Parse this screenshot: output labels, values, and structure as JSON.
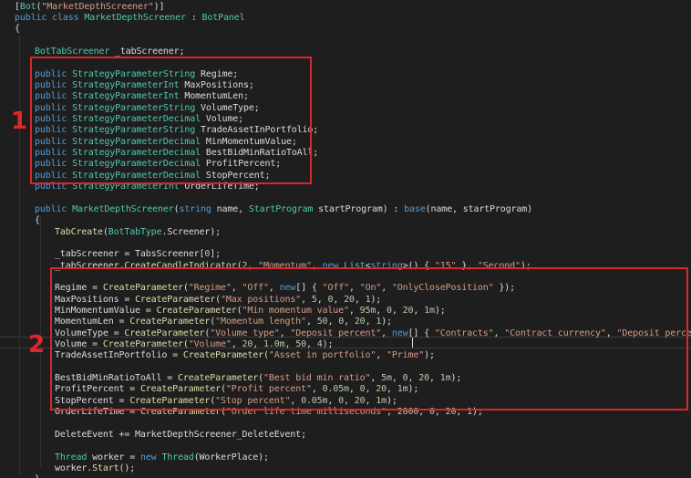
{
  "code_lines": [
    {
      "indent": 0,
      "tokens": [
        [
          "pl",
          "["
        ],
        [
          "ty",
          "Bot"
        ],
        [
          "pl",
          "("
        ],
        [
          "st",
          "\"MarketDepthScreener\""
        ],
        [
          "pl",
          ")]"
        ]
      ]
    },
    {
      "indent": 0,
      "tokens": [
        [
          "kw",
          "public"
        ],
        [
          "pl",
          " "
        ],
        [
          "kw",
          "class"
        ],
        [
          "pl",
          " "
        ],
        [
          "ty",
          "MarketDepthScreener"
        ],
        [
          "pl",
          " : "
        ],
        [
          "ty",
          "BotPanel"
        ]
      ]
    },
    {
      "indent": 0,
      "tokens": [
        [
          "pl",
          "{"
        ]
      ]
    },
    {
      "indent": 0,
      "tokens": []
    },
    {
      "indent": 1,
      "tokens": [
        [
          "ty",
          "BotTabScreener"
        ],
        [
          "pl",
          " _tabScreener;"
        ]
      ]
    },
    {
      "indent": 0,
      "tokens": []
    },
    {
      "indent": 1,
      "tokens": [
        [
          "kw",
          "public"
        ],
        [
          "pl",
          " "
        ],
        [
          "ty",
          "StrategyParameterString"
        ],
        [
          "pl",
          " Regime;"
        ]
      ]
    },
    {
      "indent": 1,
      "tokens": [
        [
          "kw",
          "public"
        ],
        [
          "pl",
          " "
        ],
        [
          "ty",
          "StrategyParameterInt"
        ],
        [
          "pl",
          " MaxPositions;"
        ]
      ]
    },
    {
      "indent": 1,
      "tokens": [
        [
          "kw",
          "public"
        ],
        [
          "pl",
          " "
        ],
        [
          "ty",
          "StrategyParameterInt"
        ],
        [
          "pl",
          " MomentumLen;"
        ]
      ]
    },
    {
      "indent": 1,
      "tokens": [
        [
          "kw",
          "public"
        ],
        [
          "pl",
          " "
        ],
        [
          "ty",
          "StrategyParameterString"
        ],
        [
          "pl",
          " VolumeType;"
        ]
      ]
    },
    {
      "indent": 1,
      "tokens": [
        [
          "kw",
          "public"
        ],
        [
          "pl",
          " "
        ],
        [
          "ty",
          "StrategyParameterDecimal"
        ],
        [
          "pl",
          " Volume;"
        ]
      ]
    },
    {
      "indent": 1,
      "tokens": [
        [
          "kw",
          "public"
        ],
        [
          "pl",
          " "
        ],
        [
          "ty",
          "StrategyParameterString"
        ],
        [
          "pl",
          " TradeAssetInPortfolio;"
        ]
      ]
    },
    {
      "indent": 1,
      "tokens": [
        [
          "kw",
          "public"
        ],
        [
          "pl",
          " "
        ],
        [
          "ty",
          "StrategyParameterDecimal"
        ],
        [
          "pl",
          " MinMomentumValue;"
        ]
      ]
    },
    {
      "indent": 1,
      "tokens": [
        [
          "kw",
          "public"
        ],
        [
          "pl",
          " "
        ],
        [
          "ty",
          "StrategyParameterDecimal"
        ],
        [
          "pl",
          " BestBidMinRatioToAll;"
        ]
      ]
    },
    {
      "indent": 1,
      "tokens": [
        [
          "kw",
          "public"
        ],
        [
          "pl",
          " "
        ],
        [
          "ty",
          "StrategyParameterDecimal"
        ],
        [
          "pl",
          " ProfitPercent;"
        ]
      ]
    },
    {
      "indent": 1,
      "tokens": [
        [
          "kw",
          "public"
        ],
        [
          "pl",
          " "
        ],
        [
          "ty",
          "StrategyParameterDecimal"
        ],
        [
          "pl",
          " StopPercent;"
        ]
      ]
    },
    {
      "indent": 1,
      "tokens": [
        [
          "kw",
          "public"
        ],
        [
          "pl",
          " "
        ],
        [
          "ty",
          "StrategyParameterInt"
        ],
        [
          "pl",
          " OrderLifeTime;"
        ]
      ]
    },
    {
      "indent": 0,
      "tokens": []
    },
    {
      "indent": 1,
      "tokens": [
        [
          "kw",
          "public"
        ],
        [
          "pl",
          " "
        ],
        [
          "ty",
          "MarketDepthScreener"
        ],
        [
          "pl",
          "("
        ],
        [
          "kw",
          "string"
        ],
        [
          "pl",
          " name, "
        ],
        [
          "ty",
          "StartProgram"
        ],
        [
          "pl",
          " startProgram) : "
        ],
        [
          "kw",
          "base"
        ],
        [
          "pl",
          "(name, startProgram)"
        ]
      ]
    },
    {
      "indent": 1,
      "tokens": [
        [
          "pl",
          "{"
        ]
      ]
    },
    {
      "indent": 2,
      "tokens": [
        [
          "mt",
          "TabCreate"
        ],
        [
          "pl",
          "("
        ],
        [
          "ty",
          "BotTabType"
        ],
        [
          "pl",
          "."
        ],
        [
          "pl",
          "Screener"
        ],
        [
          "pl",
          ");"
        ]
      ]
    },
    {
      "indent": 0,
      "tokens": []
    },
    {
      "indent": 2,
      "tokens": [
        [
          "pl",
          "_tabScreener = TabsScreener["
        ],
        [
          "nu",
          "0"
        ],
        [
          "pl",
          "];"
        ]
      ]
    },
    {
      "indent": 2,
      "tokens": [
        [
          "pl",
          "_tabScreener."
        ],
        [
          "mt",
          "CreateCandleIndicator"
        ],
        [
          "pl",
          "("
        ],
        [
          "nu",
          "2"
        ],
        [
          "pl",
          ", "
        ],
        [
          "st",
          "\"Momentum\""
        ],
        [
          "pl",
          ", "
        ],
        [
          "kw",
          "new"
        ],
        [
          "pl",
          " "
        ],
        [
          "ty",
          "List"
        ],
        [
          "pl",
          "<"
        ],
        [
          "kw",
          "string"
        ],
        [
          "pl",
          ">() { "
        ],
        [
          "st",
          "\"15\""
        ],
        [
          "pl",
          " }, "
        ],
        [
          "st",
          "\"Second\""
        ],
        [
          "pl",
          ");"
        ]
      ]
    },
    {
      "indent": 0,
      "tokens": []
    },
    {
      "indent": 2,
      "tokens": [
        [
          "pl",
          "Regime = "
        ],
        [
          "mt",
          "CreateParameter"
        ],
        [
          "pl",
          "("
        ],
        [
          "st",
          "\"Regime\""
        ],
        [
          "pl",
          ", "
        ],
        [
          "st",
          "\"Off\""
        ],
        [
          "pl",
          ", "
        ],
        [
          "kw",
          "new"
        ],
        [
          "pl",
          "[] { "
        ],
        [
          "st",
          "\"Off\""
        ],
        [
          "pl",
          ", "
        ],
        [
          "st",
          "\"On\""
        ],
        [
          "pl",
          ", "
        ],
        [
          "st",
          "\"OnlyClosePosition\""
        ],
        [
          "pl",
          " });"
        ]
      ]
    },
    {
      "indent": 2,
      "tokens": [
        [
          "pl",
          "MaxPositions = "
        ],
        [
          "mt",
          "CreateParameter"
        ],
        [
          "pl",
          "("
        ],
        [
          "st",
          "\"Max positions\""
        ],
        [
          "pl",
          ", "
        ],
        [
          "nu",
          "5"
        ],
        [
          "pl",
          ", "
        ],
        [
          "nu",
          "0"
        ],
        [
          "pl",
          ", "
        ],
        [
          "nu",
          "20"
        ],
        [
          "pl",
          ", "
        ],
        [
          "nu",
          "1"
        ],
        [
          "pl",
          ");"
        ]
      ]
    },
    {
      "indent": 2,
      "tokens": [
        [
          "pl",
          "MinMomentumValue = "
        ],
        [
          "mt",
          "CreateParameter"
        ],
        [
          "pl",
          "("
        ],
        [
          "st",
          "\"Min momentum value\""
        ],
        [
          "pl",
          ", "
        ],
        [
          "nu",
          "95m"
        ],
        [
          "pl",
          ", "
        ],
        [
          "nu",
          "0"
        ],
        [
          "pl",
          ", "
        ],
        [
          "nu",
          "20"
        ],
        [
          "pl",
          ", "
        ],
        [
          "nu",
          "1m"
        ],
        [
          "pl",
          ");"
        ]
      ]
    },
    {
      "indent": 2,
      "tokens": [
        [
          "pl",
          "MomentumLen = "
        ],
        [
          "mt",
          "CreateParameter"
        ],
        [
          "pl",
          "("
        ],
        [
          "st",
          "\"Momentum length\""
        ],
        [
          "pl",
          ", "
        ],
        [
          "nu",
          "50"
        ],
        [
          "pl",
          ", "
        ],
        [
          "nu",
          "0"
        ],
        [
          "pl",
          ", "
        ],
        [
          "nu",
          "20"
        ],
        [
          "pl",
          ", "
        ],
        [
          "nu",
          "1"
        ],
        [
          "pl",
          ");"
        ]
      ]
    },
    {
      "indent": 2,
      "tokens": [
        [
          "pl",
          "VolumeType = "
        ],
        [
          "mt",
          "CreateParameter"
        ],
        [
          "pl",
          "("
        ],
        [
          "st",
          "\"Volume type\""
        ],
        [
          "pl",
          ", "
        ],
        [
          "st",
          "\"Deposit percent\""
        ],
        [
          "pl",
          ", "
        ],
        [
          "kw",
          "new"
        ],
        [
          "pl",
          "[] { "
        ],
        [
          "st",
          "\"Contracts\""
        ],
        [
          "pl",
          ", "
        ],
        [
          "st",
          "\"Contract currency\""
        ],
        [
          "pl",
          ", "
        ],
        [
          "st",
          "\"Deposit percent\""
        ],
        [
          "pl",
          " });"
        ]
      ]
    },
    {
      "indent": 2,
      "tokens": [
        [
          "pl",
          "Volume = "
        ],
        [
          "mt",
          "CreateParameter"
        ],
        [
          "pl",
          "("
        ],
        [
          "st",
          "\"Volume\""
        ],
        [
          "pl",
          ", "
        ],
        [
          "nu",
          "20"
        ],
        [
          "pl",
          ", "
        ],
        [
          "nu",
          "1.0m"
        ],
        [
          "pl",
          ", "
        ],
        [
          "nu",
          "50"
        ],
        [
          "pl",
          ", "
        ],
        [
          "nu",
          "4"
        ],
        [
          "pl",
          ");"
        ]
      ]
    },
    {
      "indent": 2,
      "tokens": [
        [
          "pl",
          "TradeAssetInPortfolio = "
        ],
        [
          "mt",
          "CreateParameter"
        ],
        [
          "pl",
          "("
        ],
        [
          "st",
          "\"Asset in portfolio\""
        ],
        [
          "pl",
          ", "
        ],
        [
          "st",
          "\"Prime\""
        ],
        [
          "pl",
          ");"
        ]
      ]
    },
    {
      "indent": 0,
      "tokens": []
    },
    {
      "indent": 2,
      "tokens": [
        [
          "pl",
          "BestBidMinRatioToAll = "
        ],
        [
          "mt",
          "CreateParameter"
        ],
        [
          "pl",
          "("
        ],
        [
          "st",
          "\"Best bid min ratio\""
        ],
        [
          "pl",
          ", "
        ],
        [
          "nu",
          "5m"
        ],
        [
          "pl",
          ", "
        ],
        [
          "nu",
          "0"
        ],
        [
          "pl",
          ", "
        ],
        [
          "nu",
          "20"
        ],
        [
          "pl",
          ", "
        ],
        [
          "nu",
          "1m"
        ],
        [
          "pl",
          ");"
        ]
      ]
    },
    {
      "indent": 2,
      "tokens": [
        [
          "pl",
          "ProfitPercent = "
        ],
        [
          "mt",
          "CreateParameter"
        ],
        [
          "pl",
          "("
        ],
        [
          "st",
          "\"Profit percent\""
        ],
        [
          "pl",
          ", "
        ],
        [
          "nu",
          "0.05m"
        ],
        [
          "pl",
          ", "
        ],
        [
          "nu",
          "0"
        ],
        [
          "pl",
          ", "
        ],
        [
          "nu",
          "20"
        ],
        [
          "pl",
          ", "
        ],
        [
          "nu",
          "1m"
        ],
        [
          "pl",
          ");"
        ]
      ]
    },
    {
      "indent": 2,
      "tokens": [
        [
          "pl",
          "StopPercent = "
        ],
        [
          "mt",
          "CreateParameter"
        ],
        [
          "pl",
          "("
        ],
        [
          "st",
          "\"Stop percent\""
        ],
        [
          "pl",
          ", "
        ],
        [
          "nu",
          "0.05m"
        ],
        [
          "pl",
          ", "
        ],
        [
          "nu",
          "0"
        ],
        [
          "pl",
          ", "
        ],
        [
          "nu",
          "20"
        ],
        [
          "pl",
          ", "
        ],
        [
          "nu",
          "1m"
        ],
        [
          "pl",
          ");"
        ]
      ]
    },
    {
      "indent": 2,
      "tokens": [
        [
          "pl",
          "OrderLifeTime = "
        ],
        [
          "mt",
          "CreateParameter"
        ],
        [
          "pl",
          "("
        ],
        [
          "st",
          "\"Order life time milliseconds\""
        ],
        [
          "pl",
          ", "
        ],
        [
          "nu",
          "2000"
        ],
        [
          "pl",
          ", "
        ],
        [
          "nu",
          "0"
        ],
        [
          "pl",
          ", "
        ],
        [
          "nu",
          "20"
        ],
        [
          "pl",
          ", "
        ],
        [
          "nu",
          "1"
        ],
        [
          "pl",
          ");"
        ]
      ]
    },
    {
      "indent": 0,
      "tokens": []
    },
    {
      "indent": 2,
      "tokens": [
        [
          "pl",
          "DeleteEvent += MarketDepthScreener_DeleteEvent;"
        ]
      ]
    },
    {
      "indent": 0,
      "tokens": []
    },
    {
      "indent": 2,
      "tokens": [
        [
          "ty",
          "Thread"
        ],
        [
          "pl",
          " worker = "
        ],
        [
          "kw",
          "new"
        ],
        [
          "pl",
          " "
        ],
        [
          "ty",
          "Thread"
        ],
        [
          "pl",
          "(WorkerPlace);"
        ]
      ]
    },
    {
      "indent": 2,
      "tokens": [
        [
          "pl",
          "worker."
        ],
        [
          "mt",
          "Start"
        ],
        [
          "pl",
          "();"
        ]
      ]
    },
    {
      "indent": 1,
      "tokens": [
        [
          "pl",
          "}"
        ]
      ]
    }
  ],
  "annotations": [
    {
      "id": "1",
      "label": "1"
    },
    {
      "id": "2",
      "label": "2"
    }
  ],
  "colors": {
    "background": "#1e1e1e",
    "keyword": "#569cd6",
    "type": "#4ec9b0",
    "method": "#dcdcaa",
    "string": "#d69d85",
    "number": "#b5cea8",
    "plain": "#dcdcdc",
    "annotation": "#d9262c"
  }
}
